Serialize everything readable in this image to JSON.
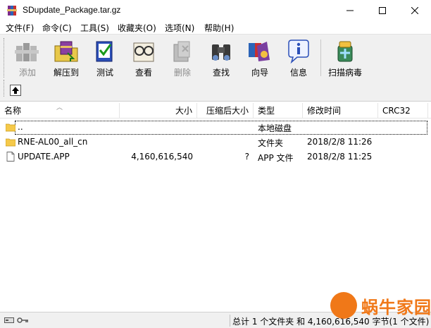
{
  "window": {
    "title": "SDupdate_Package.tar.gz"
  },
  "menu": [
    {
      "label": "文件(F)"
    },
    {
      "label": "命令(C)"
    },
    {
      "label": "工具(S)"
    },
    {
      "label": "收藏夹(O)"
    },
    {
      "label": "选项(N)"
    },
    {
      "label": "帮助(H)"
    }
  ],
  "toolbar": {
    "buttons": [
      {
        "label": "添加",
        "icon": "books-add-icon",
        "enabled": false
      },
      {
        "label": "解压到",
        "icon": "extract-folder-icon",
        "enabled": true
      },
      {
        "label": "测试",
        "icon": "test-icon",
        "enabled": true
      },
      {
        "label": "查看",
        "icon": "glasses-view-icon",
        "enabled": true
      },
      {
        "label": "删除",
        "icon": "delete-icon",
        "enabled": false
      },
      {
        "label": "查找",
        "icon": "binoculars-icon",
        "enabled": true
      },
      {
        "label": "向导",
        "icon": "wizard-icon",
        "enabled": true
      },
      {
        "label": "信息",
        "icon": "info-icon",
        "enabled": true
      },
      {
        "label": "扫描病毒",
        "icon": "virus-scan-icon",
        "enabled": true
      }
    ]
  },
  "columns": {
    "name": "名称",
    "size": "大小",
    "packed": "压缩后大小",
    "type": "类型",
    "modified": "修改时间",
    "crc": "CRC32"
  },
  "files": [
    {
      "name": "..",
      "size": "",
      "packed": "",
      "type": "本地磁盘",
      "modified": "",
      "crc": "",
      "icon": "folder-icon"
    },
    {
      "name": "RNE-AL00_all_cn",
      "size": "",
      "packed": "",
      "type": "文件夹",
      "modified": "2018/2/8 11:26",
      "crc": "",
      "icon": "folder-icon"
    },
    {
      "name": "UPDATE.APP",
      "size": "4,160,616,540",
      "packed": "?",
      "type": "APP 文件",
      "modified": "2018/2/8 11:25",
      "crc": "",
      "icon": "file-icon"
    }
  ],
  "status": {
    "text": "总计 1 个文件夹 和 4,160,616,540 字节(1 个文件)"
  },
  "watermark": {
    "text": "蜗牛家园"
  },
  "colors": {
    "folder": "#f5c94a",
    "watermark": "#f07818"
  }
}
